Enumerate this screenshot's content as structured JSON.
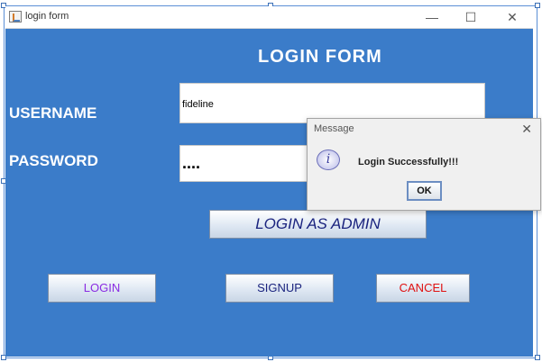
{
  "window": {
    "title": "login form",
    "minimize": "—",
    "maximize": "☐",
    "close": "✕"
  },
  "form": {
    "title": "LOGIN FORM",
    "username_label": "USERNAME",
    "password_label": "PASSWORD",
    "username_value": "fideline",
    "password_value": "....",
    "admin_button": "LOGIN AS ADMIN",
    "login_button": "LOGIN",
    "signup_button": "SIGNUP",
    "cancel_button": "CANCEL"
  },
  "dialog": {
    "title": "Message",
    "close": "✕",
    "icon_glyph": "i",
    "message": "Login Successfully!!!",
    "ok_button": "OK"
  },
  "colors": {
    "window_bg": "#3b7cc9",
    "login_text": "#8a2be2",
    "signup_text": "#1a237e",
    "cancel_text": "#e01010"
  },
  "icons": [
    "app-java-icon",
    "info-icon",
    "close-icon"
  ]
}
